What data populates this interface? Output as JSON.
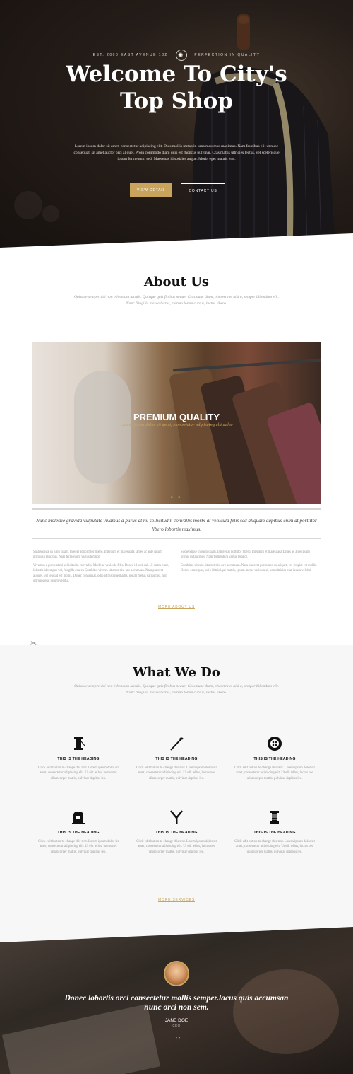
{
  "hero": {
    "topline_left": "EST. 2000 EAST AVENUE 182",
    "topline_right": "PERFECTION IN QUALITY",
    "title_line1": "Welcome To City's",
    "title_line2": "Top Shop",
    "lead": "Lorem ipsum dolor sit amet, consectetur adipiscing elit. Duis mollis metus in urna maximus maximus. Nam faucibus elit ut nunc consequat, sit amet auctor orci aliquet. Proin commodo diam quis est rhoncus pulvinar. Cras mattis ultricies lectus, vel scelerisque ipsum fermentum sed. Maecenas id sodales augue. Morbi eget mauris erat.",
    "btn_view": "VIEW DETAIL",
    "btn_contact": "CONTACT US"
  },
  "about": {
    "title": "About Us",
    "subtitle": "Quisque semper dui non bibendum iaculis. Quisque quis finibus neque. Cras nunc diam, pharetra et nisl a, semper bibendum elit. Nunc fringilla massa luctus, rutrum lorem cursus, luctus libero.",
    "slide_title": "PREMIUM QUALITY",
    "slide_caption": "Lorem ipsum dolor sit amet, consectetur adipiscing elit dolor",
    "slide_dots": "● ●",
    "quote": "Nunc molestie gravida vulputate vivamus a purus at mi sollicitudin convallis morbi at vehicula felis sed aliquam dapibus enim at porttitor libero lobortis maximus.",
    "col1_p1": "Suspendisse in justo quam. Integer at porttitor libero. Interdum et malesuada fames ac ante ipsum primis in faucibus. Nam fermentum varius tempor.",
    "col1_p2": "Vivamus a purus at mi sollicitudin convallis. Morbi at vehicula felis. Donec id orci dui. Ut quam nunc, lobortis id tempus vel, fringilla et arcu Curabitur viverra sit amet nisl nec accumsan. Nam placerat aliquet, vel feugiat est mollis. Donec consequat, odio id tristique mattis, ipsum metus varius nisi, non ultricies erat ipsum vel dui.",
    "col2_p1": "Suspendisse in justo quam. Integer at porttitor libero. Interdum et malesuada fames ac ante ipsum primis in faucibus. Nam fermentum varius tempor.",
    "col2_p2": "Curabitur viverra sit amet nisl nec accumsan. Nam placerat purus non ex aliquet, vel feugiat est mollis. Donec consequat, odio id tristique mattis, ipsum metus varius nisi, non ultricies erat ipsum vel dui.",
    "more_link": "MORE ABOUT US"
  },
  "services": {
    "title": "What We Do",
    "subtitle": "Quisque semper dui non bibendum iaculis. Quisque quis finibus neque. Cras nunc diam, pharetra et nisl a, semper bibendum elit. Nunc fringilla massa luctus, rutrum lorem cursus, luctus libero.",
    "items": [
      {
        "icon": "thread-spool-icon",
        "heading": "THIS IS THE HEADING",
        "text": "Click edit button to change this text. Lorem ipsum dolor sit amet, consectetur adipiscing elit. Ut elit tellus, luctus nec ullamcorper mattis, pulvinar dapibus leo."
      },
      {
        "icon": "needle-icon",
        "heading": "THIS IS THE HEADING",
        "text": "Click edit button to change this text. Lorem ipsum dolor sit amet, consectetur adipiscing elit. Ut elit tellus, luctus nec ullamcorper mattis, pulvinar dapibus leo."
      },
      {
        "icon": "button-icon",
        "heading": "THIS IS THE HEADING",
        "text": "Click edit button to change this text. Lorem ipsum dolor sit amet, consectetur adipiscing elit. Ut elit tellus, luctus nec ullamcorper mattis, pulvinar dapibus leo."
      },
      {
        "icon": "sewing-machine-icon",
        "heading": "THIS IS THE HEADING",
        "text": "Click edit button to change this text. Lorem ipsum dolor sit amet, consectetur adipiscing elit. Ut elit tellus, luctus nec ullamcorper mattis, pulvinar dapibus leo."
      },
      {
        "icon": "seam-ripper-icon",
        "heading": "THIS IS THE HEADING",
        "text": "Click edit button to change this text. Lorem ipsum dolor sit amet, consectetur adipiscing elit. Ut elit tellus, luctus nec ullamcorper mattis, pulvinar dapibus leo."
      },
      {
        "icon": "bobbin-icon",
        "heading": "THIS IS THE HEADING",
        "text": "Click edit button to change this text. Lorem ipsum dolor sit amet, consectetur adipiscing elit. Ut elit tellus, luctus nec ullamcorper mattis, pulvinar dapibus leo."
      }
    ],
    "more_link": "MORE SERVICES"
  },
  "testimonial": {
    "quote": "Donec lobortis orci consectetur mollis semper.lacus quis accumsan nunc orci non sem.",
    "name": "JANE DOE",
    "role": "CEO",
    "pager": "1 / 2"
  },
  "colors": {
    "accent": "#c9a45c",
    "dark": "#111111",
    "muted": "#999999"
  }
}
